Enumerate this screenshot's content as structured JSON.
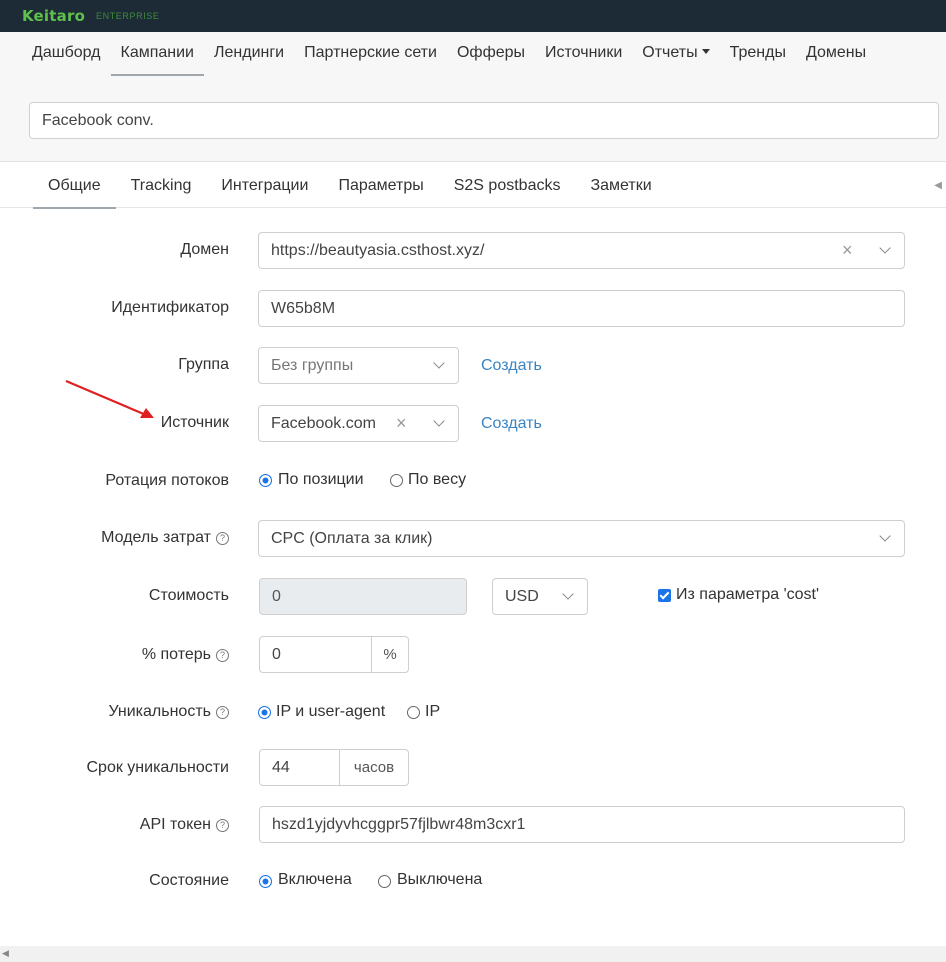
{
  "brand": {
    "name": "Keitaro",
    "edition": "ENTERPRISE"
  },
  "nav": {
    "items": [
      {
        "label": "Дашборд"
      },
      {
        "label": "Кампании",
        "active": true
      },
      {
        "label": "Лендинги"
      },
      {
        "label": "Партнерские сети"
      },
      {
        "label": "Офферы"
      },
      {
        "label": "Источники"
      },
      {
        "label": "Отчеты",
        "dropdown": true
      },
      {
        "label": "Тренды"
      },
      {
        "label": "Домены"
      }
    ]
  },
  "campaign": {
    "name": "Facebook conv."
  },
  "tabs": [
    {
      "label": "Общие",
      "active": true
    },
    {
      "label": "Tracking"
    },
    {
      "label": "Интеграции"
    },
    {
      "label": "Параметры"
    },
    {
      "label": "S2S postbacks"
    },
    {
      "label": "Заметки"
    }
  ],
  "form": {
    "domain": {
      "label": "Домен",
      "value": "https://beautyasia.csthost.xyz/"
    },
    "identifier": {
      "label": "Идентификатор",
      "value": "W65b8M"
    },
    "group": {
      "label": "Группа",
      "value": "Без группы",
      "create": "Создать"
    },
    "source": {
      "label": "Источник",
      "value": "Facebook.com",
      "create": "Создать"
    },
    "rotation": {
      "label": "Ротация потоков",
      "options": [
        "По позиции",
        "По весу"
      ],
      "selected": "По позиции"
    },
    "cost_model": {
      "label": "Модель затрат",
      "value": "CPC (Оплата за клик)"
    },
    "cost": {
      "label": "Стоимость",
      "value": "0",
      "currency": "USD",
      "from_param_label": "Из параметра 'cost'",
      "from_param_checked": true
    },
    "loss": {
      "label": "% потерь",
      "value": "0",
      "unit": "%"
    },
    "uniqueness": {
      "label": "Уникальность",
      "options": [
        "IP и user-agent",
        "IP"
      ],
      "selected": "IP и user-agent"
    },
    "uniqueness_period": {
      "label": "Срок уникальности",
      "value": "44",
      "unit": "часов"
    },
    "api_token": {
      "label": "API токен",
      "value": "hszd1yjdyvhcggpr57fjlbwr48m3cxr1"
    },
    "state": {
      "label": "Состояние",
      "options": [
        "Включена",
        "Выключена"
      ],
      "selected": "Включена"
    }
  },
  "colors": {
    "topbar": "#1d2b36",
    "brand": "#5ec14b",
    "link": "#3a84c4",
    "accent": "#1a73e8",
    "annotation_arrow": "#e02020"
  }
}
